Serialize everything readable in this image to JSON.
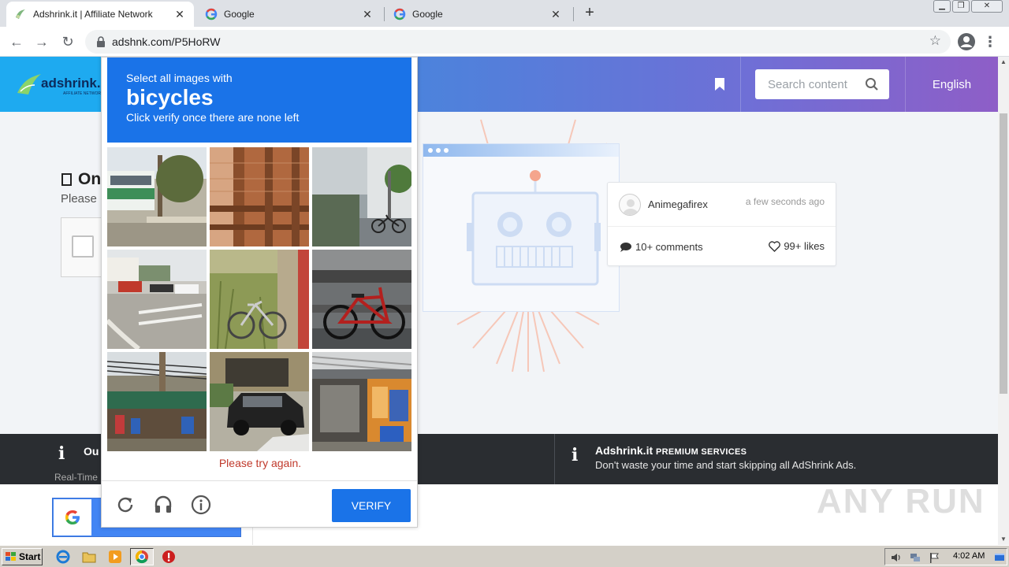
{
  "browser": {
    "tabs": [
      {
        "title": "Adshrink.it | Affiliate Network",
        "active": true,
        "icon": "adshrink-favicon"
      },
      {
        "title": "Google",
        "active": false,
        "icon": "google-favicon"
      },
      {
        "title": "Google",
        "active": false,
        "icon": "google-favicon"
      }
    ],
    "url": "adshnk.com/P5HoRW"
  },
  "site": {
    "search_placeholder": "Search content",
    "language": "English",
    "logo_text": "adshrink.it",
    "logo_sub": "AFFILIATE NETWORK"
  },
  "background": {
    "title_fragment": "On",
    "please_fragment": "Please"
  },
  "post": {
    "author": "Animegafirex",
    "time": "a few seconds ago",
    "comments": "10+ comments",
    "likes": "99+ likes"
  },
  "info_band": {
    "left_title": "Ou",
    "left_sub": "Real-Time",
    "right_brand": "Adshrink.it",
    "right_sub": "PREMIUM SERVICES",
    "right_desc": "Don't waste your time and start skipping all AdShrink Ads."
  },
  "google_button": {
    "letter": "G"
  },
  "watermark": "ANY RUN",
  "captcha": {
    "instruction": "Select all images with",
    "target": "bicycles",
    "hint": "Click verify once there are none left",
    "error": "Please try again.",
    "verify_label": "VERIFY",
    "tiles": [
      "street-with-bus",
      "wooden-railing",
      "building-with-bicycle",
      "road-intersection",
      "bicycle-in-grass",
      "red-bicycle",
      "market-street",
      "parked-cars",
      "storefront"
    ]
  },
  "taskbar": {
    "start_label": "Start",
    "clock": "4:02 AM"
  },
  "colors": {
    "captcha_blue": "#1a73e8",
    "error_red": "#c0392b",
    "band_dark": "#2a2d31"
  }
}
